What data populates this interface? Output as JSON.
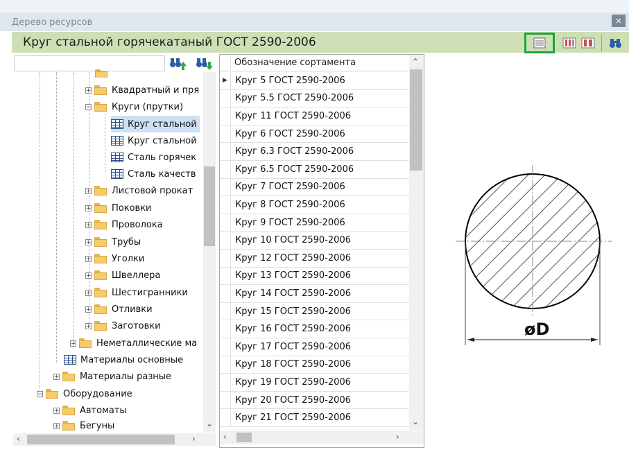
{
  "window": {
    "title": "Дерево ресурсов",
    "close_label": "×"
  },
  "header": {
    "title": "Круг стальной горячекатаный ГОСТ 2590-2006"
  },
  "toolbar": {
    "icons": [
      "list-view-icon",
      "columns-view-icon",
      "split-view-icon",
      "binoculars-icon"
    ],
    "highlight_color": "#1aa637"
  },
  "tree": {
    "search_value": "",
    "items": [
      {
        "label": "Квадратный и пря",
        "type": "folder",
        "expander": "+"
      },
      {
        "label": "Круги (прутки)",
        "type": "folder",
        "expander": "−"
      },
      {
        "label": "Круг стальной",
        "type": "table",
        "selected": true
      },
      {
        "label": "Круг стальной",
        "type": "table"
      },
      {
        "label": "Сталь горячек",
        "type": "table"
      },
      {
        "label": "Сталь качеств",
        "type": "table"
      },
      {
        "label": "Листовой прокат",
        "type": "folder",
        "expander": "+"
      },
      {
        "label": "Поковки",
        "type": "folder",
        "expander": "+"
      },
      {
        "label": "Проволока",
        "type": "folder",
        "expander": "+"
      },
      {
        "label": "Трубы",
        "type": "folder",
        "expander": "+"
      },
      {
        "label": "Уголки",
        "type": "folder",
        "expander": "+"
      },
      {
        "label": "Швеллера",
        "type": "folder",
        "expander": "+"
      },
      {
        "label": "Шестигранники",
        "type": "folder",
        "expander": "+"
      },
      {
        "label": "Отливки",
        "type": "folder",
        "expander": "+"
      },
      {
        "label": "Заготовки",
        "type": "folder",
        "expander": "+"
      },
      {
        "label": "Неметаллические ма",
        "type": "folder",
        "expander": "+"
      },
      {
        "label": "Материалы основные",
        "type": "table"
      },
      {
        "label": "Материалы разные",
        "type": "folder",
        "expander": "+"
      },
      {
        "label": "Оборудование",
        "type": "folder",
        "expander": "−"
      },
      {
        "label": "Автоматы",
        "type": "folder",
        "expander": "+"
      },
      {
        "label": "Бегуны",
        "type": "folder",
        "expander": "+"
      }
    ]
  },
  "grid": {
    "column_header": "Обозначение сортамента",
    "current_row_marker": "▶",
    "rows": [
      "Круг 5 ГОСТ 2590-2006",
      "Круг 5.5 ГОСТ 2590-2006",
      "Круг 11 ГОСТ 2590-2006",
      "Круг 6 ГОСТ 2590-2006",
      "Круг 6.3 ГОСТ 2590-2006",
      "Круг 6.5 ГОСТ 2590-2006",
      "Круг 7 ГОСТ 2590-2006",
      "Круг 8 ГОСТ 2590-2006",
      "Круг 9 ГОСТ 2590-2006",
      "Круг 10 ГОСТ 2590-2006",
      "Круг 12 ГОСТ 2590-2006",
      "Круг 13 ГОСТ 2590-2006",
      "Круг 14 ГОСТ 2590-2006",
      "Круг 15 ГОСТ 2590-2006",
      "Круг 16 ГОСТ 2590-2006",
      "Круг 17 ГОСТ 2590-2006",
      "Круг 18 ГОСТ 2590-2006",
      "Круг 19 ГОСТ 2590-2006",
      "Круг 20 ГОСТ 2590-2006",
      "Круг 21 ГОСТ 2590-2006"
    ]
  },
  "drawing": {
    "dimension_label": "øD"
  }
}
